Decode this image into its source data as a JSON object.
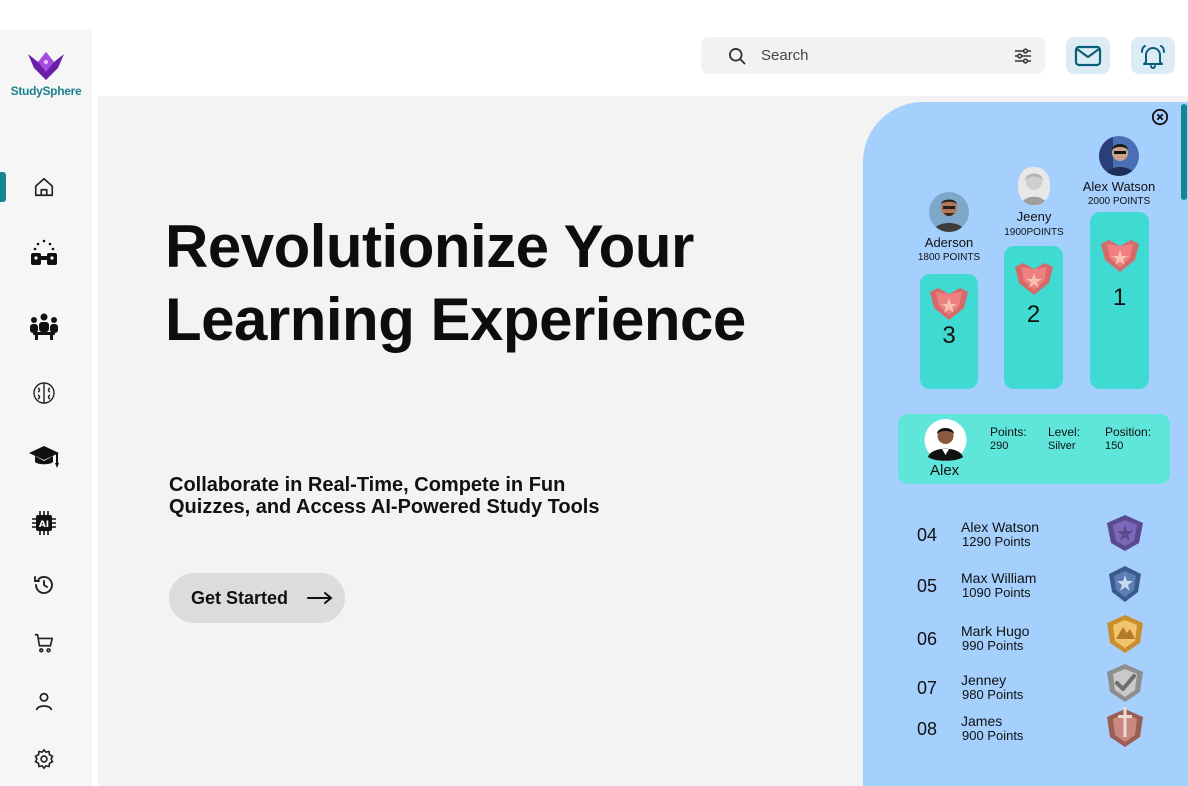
{
  "app": {
    "name": "StudySphere"
  },
  "search": {
    "placeholder": "Search"
  },
  "hero": {
    "title": "Revolutionize Your Learning Experience",
    "subtitle": "Collaborate in Real-Time, Compete in Fun Quizzes, and Access AI-Powered Study Tools",
    "cta_label": "Get Started"
  },
  "sidebar": {
    "icons": [
      "home-icon",
      "group-study-icon",
      "community-icon",
      "brain-icon",
      "graduation-cap-icon",
      "ai-chip-icon",
      "history-icon",
      "cart-icon",
      "profile-icon",
      "settings-icon"
    ],
    "active_index": 0
  },
  "leaderboard": {
    "podium": [
      {
        "rank": "1",
        "name": "Alex Watson",
        "points": "2000 POINTS"
      },
      {
        "rank": "2",
        "name": "Jeeny",
        "points": "1900POINTS"
      },
      {
        "rank": "3",
        "name": "Aderson",
        "points": "1800 POINTS"
      }
    ],
    "me": {
      "name": "Alex",
      "points_label": "Points:",
      "points_value": "290",
      "level_label": "Level:",
      "level_value": "Silver",
      "position_label": "Position:",
      "position_value": "150"
    },
    "rows": [
      {
        "rank": "04",
        "name": "Alex Watson",
        "points": "1290 Points",
        "badge": "purple-shield-badge"
      },
      {
        "rank": "05",
        "name": "Max William",
        "points": "1090 Points",
        "badge": "blue-star-badge"
      },
      {
        "rank": "06",
        "name": "Mark Hugo",
        "points": "990 Points",
        "badge": "gold-mountain-badge"
      },
      {
        "rank": "07",
        "name": "Jenney",
        "points": "980 Points",
        "badge": "silver-check-badge"
      },
      {
        "rank": "08",
        "name": "James",
        "points": "900 Points",
        "badge": "bronze-sword-badge"
      }
    ]
  },
  "colors": {
    "accent": "#14868f",
    "panel": "#a5d0fd",
    "podium": "#3fdbd2",
    "me_card": "#5fe5da",
    "header_button": "#dcecf6"
  }
}
